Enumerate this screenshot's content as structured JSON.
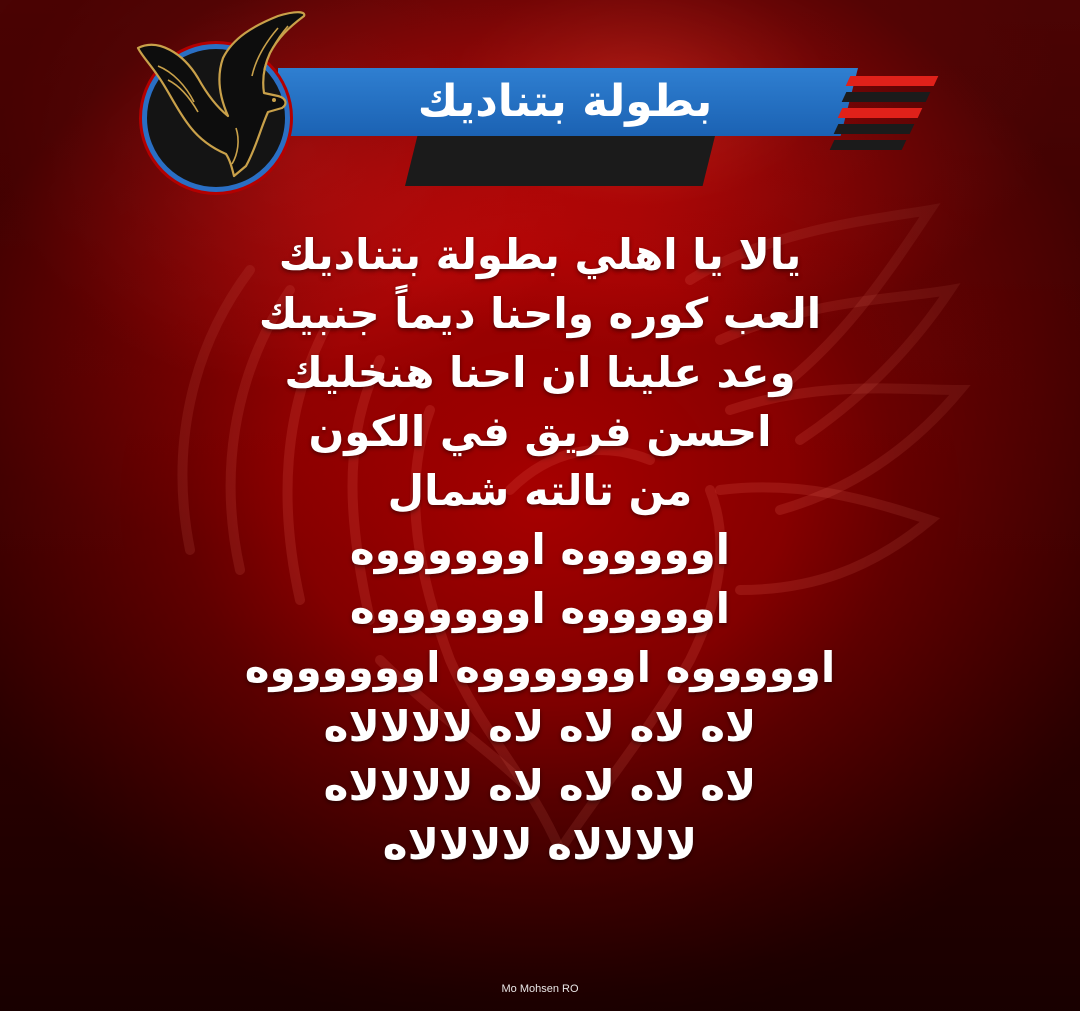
{
  "header": {
    "title": "بطولة بتناديك",
    "banner_color": "#1f68b8",
    "accent_red": "#e0211a",
    "dark": "#1b1b1b"
  },
  "logo": {
    "icon": "eagle-icon",
    "ring_color": "#2a6fc4"
  },
  "lyrics": [
    "يالا يا اهلي بطولة بتناديك",
    "العب كوره واحنا ديماً جنبيك",
    "وعد علينا ان احنا هنخليك",
    "احسن فريق في الكون",
    "من تالته شمال",
    "اوووووه اووووووه",
    "اوووووه اووووووه",
    "اوووووه اووووووه اووووووه",
    "لاه لاه لاه لاه لالالالاه",
    "لاه لاه لاه لاه لالالالاه",
    "لالالالاه لالالالاه"
  ],
  "background": {
    "primary": "#b50505",
    "deep": "#3a0000",
    "watermark_icon": "eagle-watermark-icon"
  },
  "credit": "Mo Mohsen RO"
}
